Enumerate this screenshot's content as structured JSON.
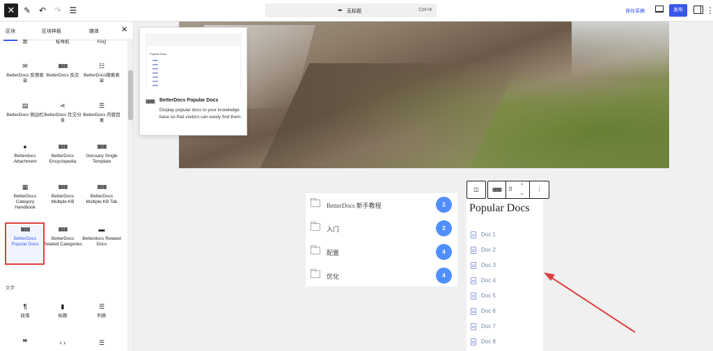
{
  "topbar": {
    "close_icon": "close-icon",
    "document_title": "无标题",
    "shortcut": "Ctrl+K",
    "save_draft": "保存草稿",
    "publish": "发布"
  },
  "sidebar": {
    "tabs": [
      "区块",
      "区块样板",
      "媒体"
    ],
    "cut_labels": [
      "期",
      "标导航",
      "FAQ"
    ],
    "blocks": [
      {
        "label": "BetterDocs 反馈表单",
        "icon": "mail-icon"
      },
      {
        "label": "BetterDocs 反应",
        "icon": "reactions-icon"
      },
      {
        "label": "BetterDocs搜索表单",
        "icon": "search-form-icon"
      },
      {
        "label": "BetterDocs 侧边栏",
        "icon": "sidebar-icon"
      },
      {
        "label": "BetterDocs 社交分享",
        "icon": "share-icon"
      },
      {
        "label": "BetterDocs 内容目录",
        "icon": "toc-icon"
      },
      {
        "label": "Betterdocs Attachment",
        "icon": "attachment-icon"
      },
      {
        "label": "BetterDocs Encyclopedia",
        "icon": "grid-icon"
      },
      {
        "label": "Glossary Single Template",
        "icon": "grid-icon"
      },
      {
        "label": "BetterDocs Category Handbook",
        "icon": "handbook-icon"
      },
      {
        "label": "BetterDocs Multiple KB",
        "icon": "grid-icon"
      },
      {
        "label": "BetterDocs Multiple KB Tab",
        "icon": "grid-icon"
      },
      {
        "label": "BetterDocs Popular Docs",
        "icon": "grid-icon"
      },
      {
        "label": "BetterDocs Related Categories",
        "icon": "grid-icon"
      },
      {
        "label": "Betterdocs Related Docs",
        "icon": "related-docs-icon"
      }
    ],
    "text_section": "文字",
    "text_blocks": [
      {
        "label": "段落",
        "icon": "paragraph-icon"
      },
      {
        "label": "标题",
        "icon": "bookmark-icon"
      },
      {
        "label": "列表",
        "icon": "list-icon"
      }
    ]
  },
  "tooltip": {
    "preview_title": "Popular Docs",
    "title": "BetterDocs Popular Docs",
    "description": "Display popular docs to your knowledge base so that visitors can easily find them."
  },
  "categories": [
    {
      "name": "BetterDocs 新手教程",
      "count": "2"
    },
    {
      "name": "入门",
      "count": "2"
    },
    {
      "name": "配置",
      "count": "4"
    },
    {
      "name": "优化",
      "count": "4"
    }
  ],
  "popular_docs": {
    "title": "Popular Docs",
    "docs": [
      "Doc 1",
      "Doc 2",
      "Doc 3",
      "Doc 4",
      "Doc 5",
      "Doc 6",
      "Doc 7",
      "Doc 8"
    ]
  },
  "colors": {
    "accent": "#3858e9",
    "badge": "#528ffe",
    "annotation": "#e13b3b"
  }
}
